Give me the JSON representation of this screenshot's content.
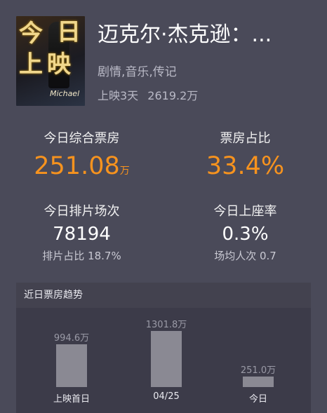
{
  "movie": {
    "title": "迈克尔·杰克逊：...",
    "genre": "剧情,音乐,传记",
    "release_days": "上映3天",
    "total_gross": "2619.2万",
    "poster_text": [
      "今",
      "日",
      "上",
      "映"
    ],
    "poster_signature": "Michael"
  },
  "stats": {
    "today_box": {
      "label": "今日综合票房",
      "value": "251.08",
      "unit": "万"
    },
    "box_share": {
      "label": "票房占比",
      "value": "33.4%"
    },
    "screenings": {
      "label": "今日排片场次",
      "value": "78194",
      "sub": "排片占比 18.7%"
    },
    "occupancy": {
      "label": "今日上座率",
      "value": "0.3%",
      "sub": "场均人次 0.7"
    }
  },
  "trend": {
    "title": "近日票房趋势"
  },
  "chart_data": {
    "type": "bar",
    "categories": [
      "上映首日",
      "04/25",
      "今日"
    ],
    "values": [
      994.6,
      1301.8,
      251.0
    ],
    "value_labels": [
      "994.6万",
      "1301.8万",
      "251.0万"
    ]
  },
  "colors": {
    "accent": "#f7931e",
    "background": "#4a4a59",
    "panel": "#3c3b49",
    "bar": "#8a8993"
  }
}
